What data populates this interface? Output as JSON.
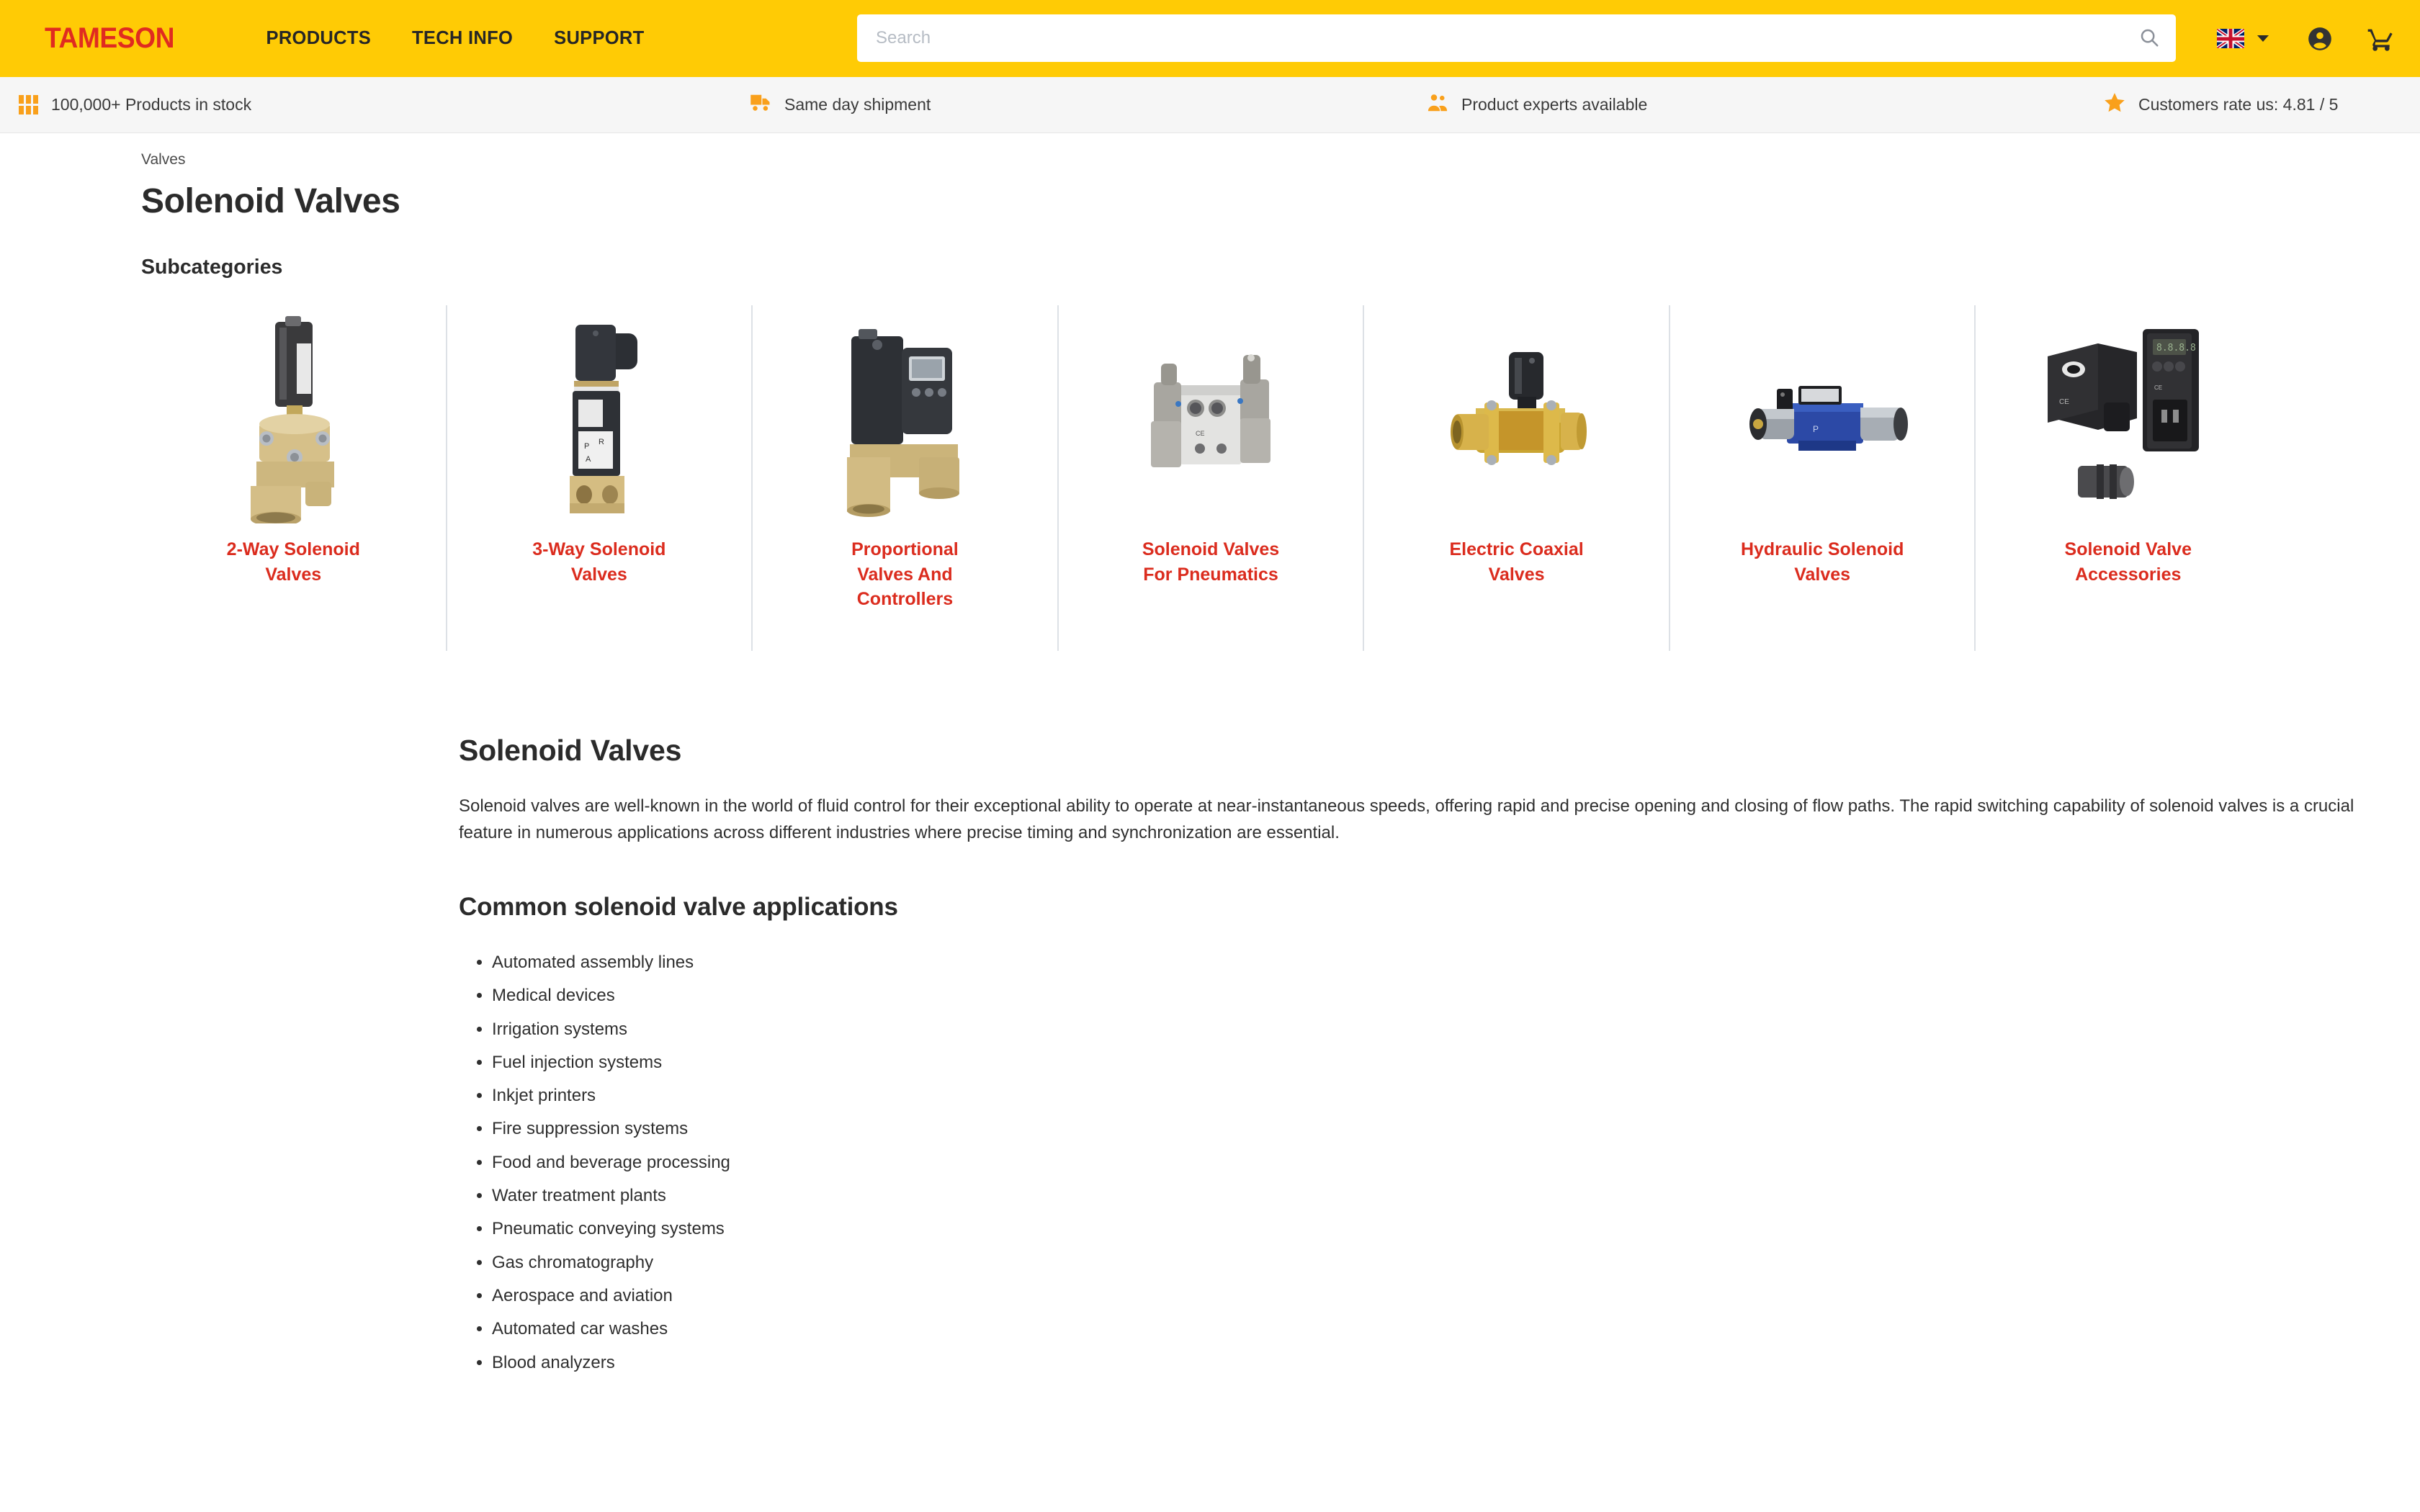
{
  "header": {
    "logo": "TAMESON",
    "nav": [
      {
        "label": "PRODUCTS"
      },
      {
        "label": "TECH INFO"
      },
      {
        "label": "SUPPORT"
      }
    ],
    "search": {
      "placeholder": "Search",
      "value": "",
      "icon": "search-icon"
    },
    "language": {
      "flag": "uk-flag-icon",
      "caret": "chevron-down-icon"
    },
    "account_icon": "account-circle-icon",
    "cart_icon": "shopping-cart-icon",
    "background_color": "#FFCB05",
    "logo_color": "#E02B20"
  },
  "usp_bar": {
    "items": [
      {
        "icon": "grid-icon",
        "label": "100,000+ Products in stock"
      },
      {
        "icon": "truck-icon",
        "label": "Same day shipment"
      },
      {
        "icon": "people-icon",
        "label": "Product experts available"
      },
      {
        "icon": "star-icon",
        "label": "Customers rate us: 4.81 / 5"
      }
    ],
    "icon_color": "#F9A01B",
    "background_color": "#F6F6F6"
  },
  "breadcrumb": {
    "items": [
      "Valves"
    ]
  },
  "page_title": "Solenoid Valves",
  "subcategories_heading": "Subcategories",
  "subcategories": [
    {
      "label": "2-Way Solenoid Valves",
      "image": "brass-2way-solenoid-valve-photo"
    },
    {
      "label": "3-Way Solenoid Valves",
      "image": "burkert-3way-solenoid-valve-photo"
    },
    {
      "label": "Proportional Valves And Controllers",
      "image": "proportional-valve-controller-photo"
    },
    {
      "label": "Solenoid Valves For Pneumatics",
      "image": "pneumatic-solenoid-valve-photo"
    },
    {
      "label": "Electric Coaxial Valves",
      "image": "brass-coaxial-valve-photo"
    },
    {
      "label": "Hydraulic Solenoid Valves",
      "image": "hydraulic-directional-valve-photo"
    },
    {
      "label": "Solenoid Valve Accessories",
      "image": "solenoid-coil-and-timer-photo"
    }
  ],
  "link_color": "#DB2C1E",
  "article": {
    "title": "Solenoid Valves",
    "paragraphs": [
      "Solenoid valves are well-known in the world of fluid control for their exceptional ability to operate at near-instantaneous speeds, offering rapid and precise opening and closing of flow paths. The rapid switching capability of solenoid valves is a crucial feature in numerous applications across different industries where precise timing and synchronization are essential."
    ],
    "applications_heading": "Common solenoid valve applications",
    "applications": [
      "Automated assembly lines",
      "Medical devices",
      "Irrigation systems",
      "Fuel injection systems",
      "Inkjet printers",
      "Fire suppression systems",
      "Food and beverage processing",
      "Water treatment plants",
      "Pneumatic conveying systems",
      "Gas chromatography",
      "Aerospace and aviation",
      "Automated car washes",
      "Blood analyzers"
    ]
  }
}
